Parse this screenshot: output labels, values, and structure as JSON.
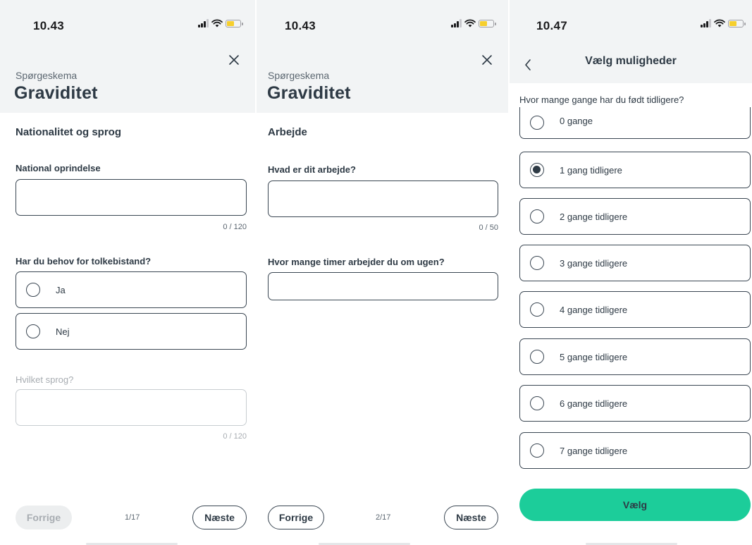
{
  "screen1": {
    "time": "10.43",
    "kicker": "Spørgeskema",
    "title": "Graviditet",
    "section": "Nationalitet og sprog",
    "q1_label": "National oprindelse",
    "q1_counter": "0 / 120",
    "q2_label": "Har du behov for tolkebistand?",
    "q2_options": [
      "Ja",
      "Nej"
    ],
    "q3_label": "Hvilket sprog?",
    "q3_counter": "0 / 120",
    "prev_label": "Forrige",
    "pager": "1/17",
    "next_label": "Næste"
  },
  "screen2": {
    "time": "10.43",
    "kicker": "Spørgeskema",
    "title": "Graviditet",
    "section": "Arbejde",
    "q1_label": "Hvad er dit arbejde?",
    "q1_counter": "0 / 50",
    "q2_label": "Hvor mange timer arbejder du om ugen?",
    "prev_label": "Forrige",
    "pager": "2/17",
    "next_label": "Næste"
  },
  "screen3": {
    "time": "10.47",
    "nav_title": "Vælg muligheder",
    "question": "Hvor mange gange har du født tidligere?",
    "options": [
      "0 gange",
      "1 gang tidligere",
      "2 gange tidligere",
      "3 gange tidligere",
      "4 gange tidligere",
      "5 gange tidligere",
      "6 gange tidligere",
      "7 gange tidligere"
    ],
    "selected_index": 1,
    "select_label": "Vælg"
  },
  "colors": {
    "accent": "#1ccd9a",
    "text": "#2e3a45",
    "header_bg": "#f2f4f5",
    "battery": "#f6cf2d"
  },
  "icons": [
    "signal-icon",
    "wifi-icon",
    "battery-icon",
    "close-icon",
    "back-chevron-icon",
    "radio-icon"
  ]
}
